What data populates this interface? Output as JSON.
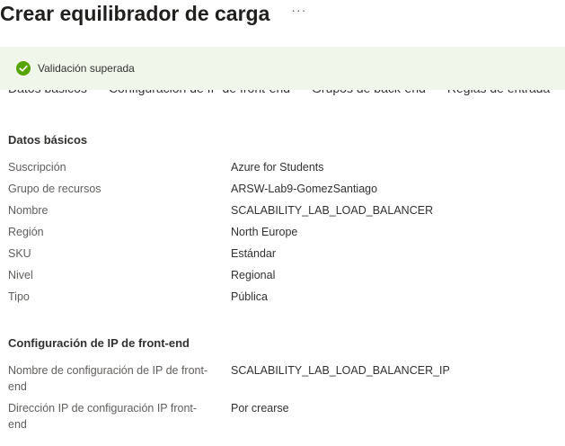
{
  "header": {
    "title": "Crear equilibrador de carga",
    "more_label": "···"
  },
  "tabs": [
    {
      "label": "Datos básicos"
    },
    {
      "label": "Configuración de IP de front-end"
    },
    {
      "label": "Grupos de back-end"
    },
    {
      "label": "Reglas de entrada"
    }
  ],
  "banner": {
    "text": "Validación superada",
    "icon": "check-circle-icon",
    "color": "#57a300"
  },
  "basics": {
    "title": "Datos básicos",
    "rows": [
      {
        "label": "Suscripción",
        "value": "Azure for Students"
      },
      {
        "label": "Grupo de recursos",
        "value": "ARSW-Lab9-GomezSantiago"
      },
      {
        "label": "Nombre",
        "value": "SCALABILITY_LAB_LOAD_BALANCER"
      },
      {
        "label": "Región",
        "value": "North Europe"
      },
      {
        "label": "SKU",
        "value": "Estándar"
      },
      {
        "label": "Nivel",
        "value": "Regional"
      },
      {
        "label": "Tipo",
        "value": "Pública"
      }
    ]
  },
  "frontend": {
    "title": "Configuración de IP de front-end",
    "rows": [
      {
        "label_line1": "Nombre de configuración de IP de front-",
        "label_line2": "end",
        "value": "SCALABILITY_LAB_LOAD_BALANCER_IP"
      },
      {
        "label_line1": "Dirección IP de configuración IP front-",
        "label_line2": "end",
        "value": "Por crearse"
      }
    ]
  }
}
